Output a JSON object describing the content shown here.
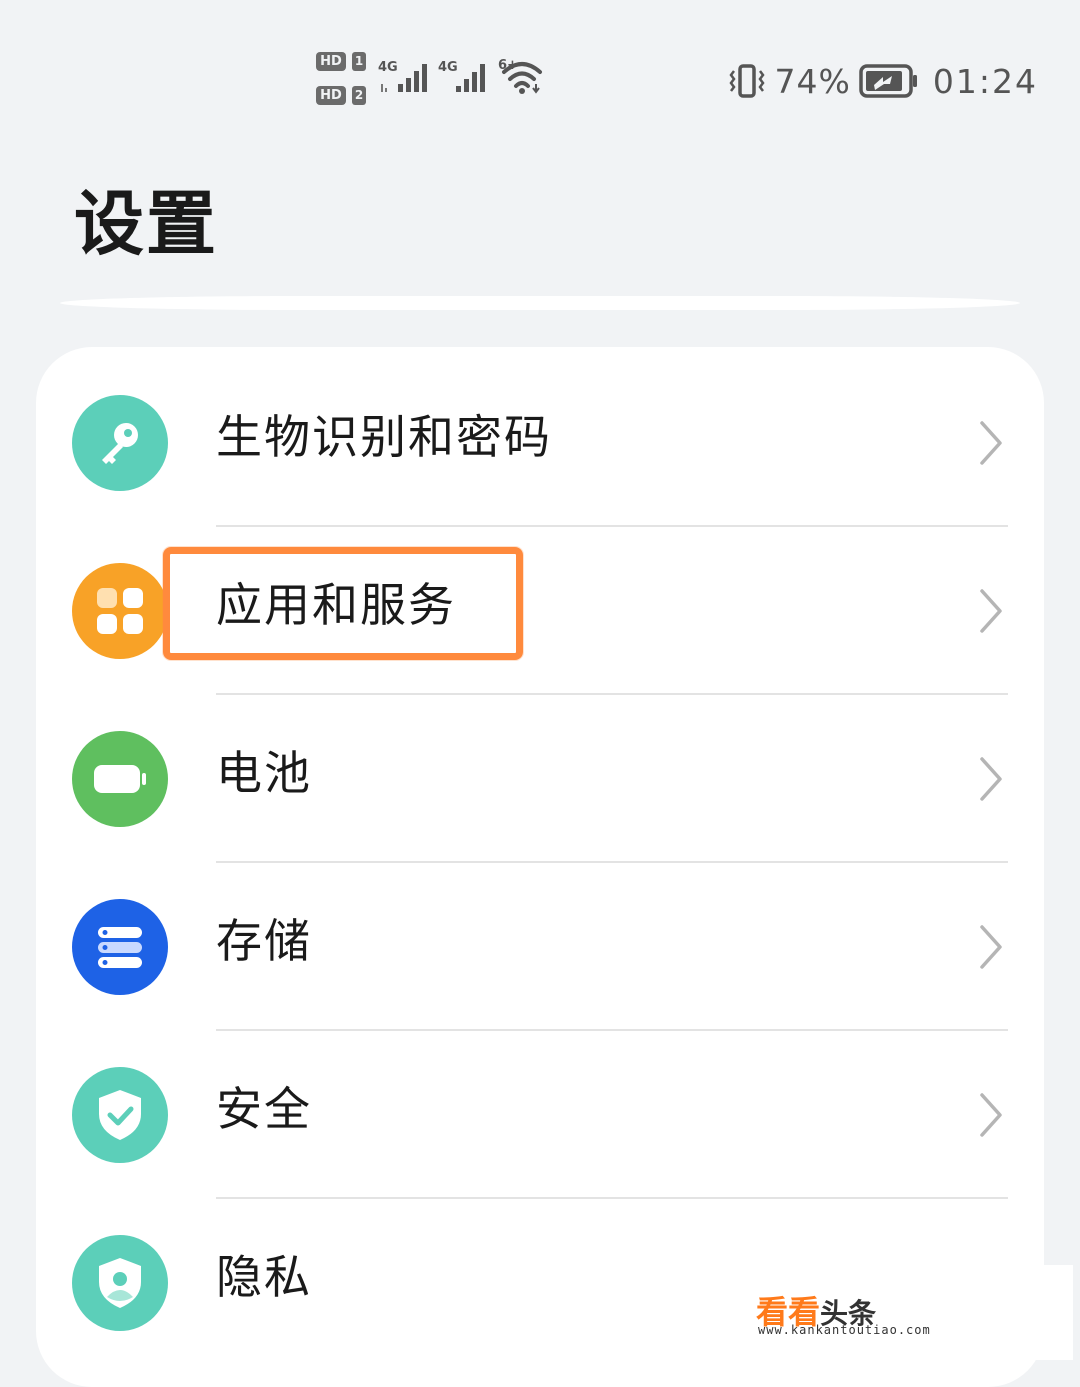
{
  "status_bar": {
    "sim1_hd": "HD",
    "sim1_num": "1",
    "sim2_hd": "HD",
    "sim2_num": "2",
    "network1": "4G",
    "network2": "4G",
    "wifi_label": "6+",
    "battery_percent": "74%",
    "time": "01:24"
  },
  "page": {
    "title": "设置"
  },
  "settings_items": [
    {
      "label": "生物识别和密码",
      "icon": "key-icon",
      "icon_color": "#5ccfb9"
    },
    {
      "label": "应用和服务",
      "icon": "apps-grid-icon",
      "icon_color": "#f8a227"
    },
    {
      "label": "电池",
      "icon": "battery-icon",
      "icon_color": "#5fbf5f"
    },
    {
      "label": "存储",
      "icon": "storage-icon",
      "icon_color": "#1e62e6"
    },
    {
      "label": "安全",
      "icon": "shield-check-icon",
      "icon_color": "#5ccfb9"
    },
    {
      "label": "隐私",
      "icon": "privacy-shield-icon",
      "icon_color": "#5ccfb9"
    }
  ],
  "highlight": {
    "color": "#ff8a3d"
  },
  "watermark": {
    "brand_part1": "看看",
    "brand_part2": "头条",
    "url": "www.kankantoutiao.com"
  }
}
